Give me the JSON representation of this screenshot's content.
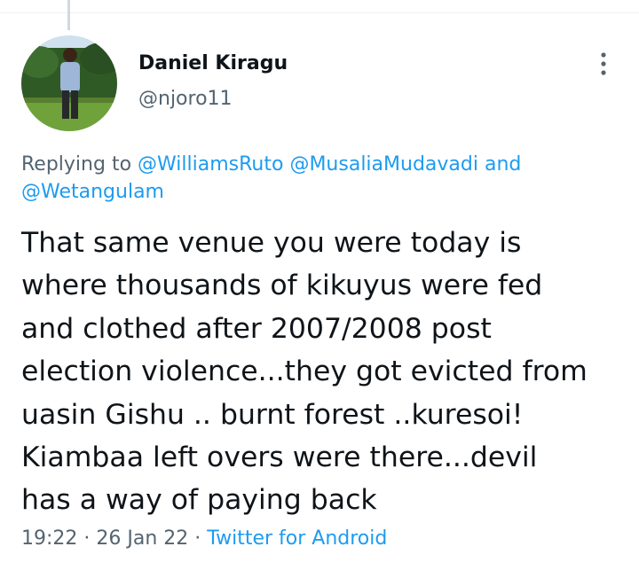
{
  "tweet": {
    "author": {
      "display_name": "Daniel Kiragu",
      "handle": "@njoro11"
    },
    "reply_context": {
      "prefix": "Replying to",
      "mentions": [
        "@WilliamsRuto",
        "@MusaliaMudavadi",
        "@Wetangulam"
      ],
      "conjunction": "and"
    },
    "text_lines": [
      "That same venue you were today is",
      "where thousands of kikuyus were fed",
      "and clothed after 2007/2008 post",
      "election violence...they got evicted from",
      "uasin Gishu .. burnt forest ..kuresoi!",
      "Kiambaa left overs were there...devil",
      "has a way of paying back"
    ],
    "time": "19:22",
    "date": "26 Jan 22",
    "separator": "·",
    "source": "Twitter for Android"
  },
  "icons": {
    "more": "more-vertical-icon",
    "avatar": "profile-photo"
  },
  "colors": {
    "link": "#1d9bf0",
    "secondary_text": "#536471",
    "primary_text": "#0f1419",
    "divider": "#eff3f4",
    "thread_line": "#cfd9de"
  }
}
